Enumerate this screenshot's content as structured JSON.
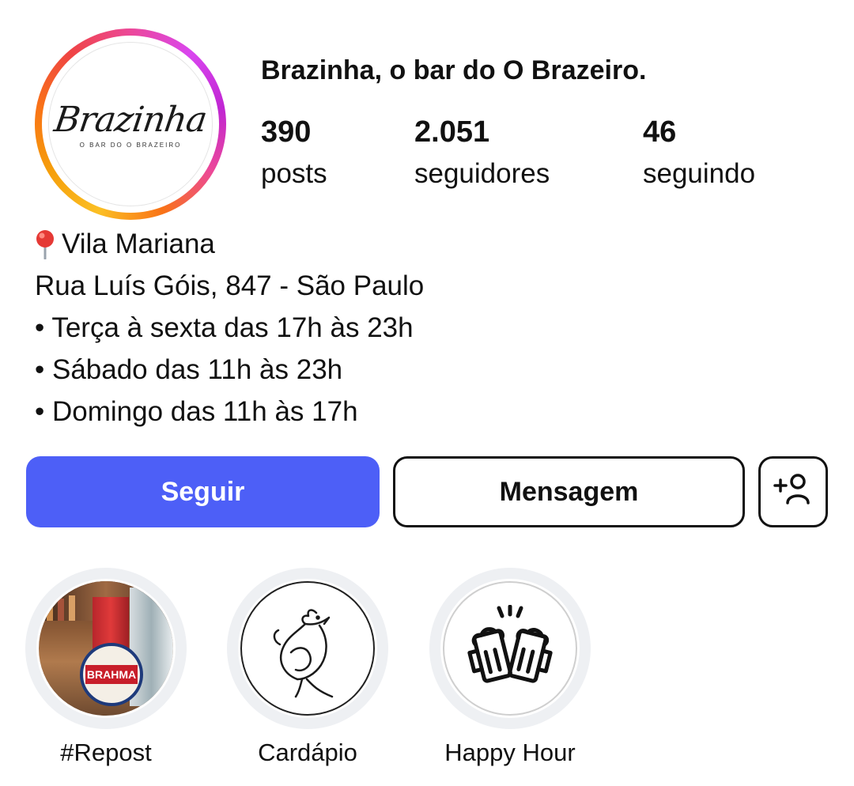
{
  "profile": {
    "name": "Brazinha, o bar do O Brazeiro.",
    "avatar_logo_text": "Brazinha",
    "avatar_logo_subtitle": "O BAR DO O BRAZEIRO"
  },
  "stats": [
    {
      "value": "390",
      "label": "posts"
    },
    {
      "value": "2.051",
      "label": "seguidores"
    },
    {
      "value": "46",
      "label": "seguindo"
    }
  ],
  "bio": {
    "location": "Vila Mariana",
    "address": "Rua Luís Góis, 847 - São Paulo",
    "hours": [
      "• Terça à sexta das 17h às 23h",
      "• Sábado das 11h às 23h",
      "• Domingo das 11h às 17h"
    ]
  },
  "actions": {
    "follow_label": "Seguir",
    "message_label": "Mensagem",
    "add_user_icon": "add-user-icon"
  },
  "highlights": [
    {
      "label": "#Repost",
      "icon": "repost-photo",
      "photo_text": "BRAHMA"
    },
    {
      "label": "Cardápio",
      "icon": "rooster-icon"
    },
    {
      "label": "Happy Hour",
      "icon": "beer-mugs-icon"
    }
  ],
  "colors": {
    "follow_button": "#4d5ff7",
    "story_ring_start": "#fbbf24",
    "story_ring_end": "#d946ef",
    "highlight_ring": "#eef0f3"
  }
}
